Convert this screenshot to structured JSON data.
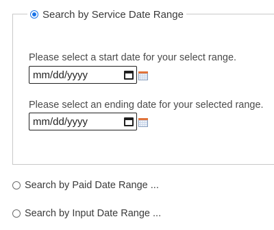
{
  "service_range": {
    "legend_label": "Search by Service Date Range",
    "selected": true,
    "start": {
      "prompt": "Please select a start date for your select range.",
      "placeholder": "mm/dd/yyyy"
    },
    "end": {
      "prompt": "Please select an ending date for your selected range.",
      "placeholder": "mm/dd/yyyy"
    }
  },
  "options": [
    {
      "label": "Search by Paid Date Range ...",
      "selected": false
    },
    {
      "label": "Search by Input Date Range ...",
      "selected": false
    }
  ],
  "icons": {
    "native_picker": "calendar-icon",
    "popup_picker": "calendar-popup-icon"
  },
  "colors": {
    "radio_selected": "#1a73e8",
    "border": "#c8c8c8",
    "text": "#3a3a3a"
  }
}
